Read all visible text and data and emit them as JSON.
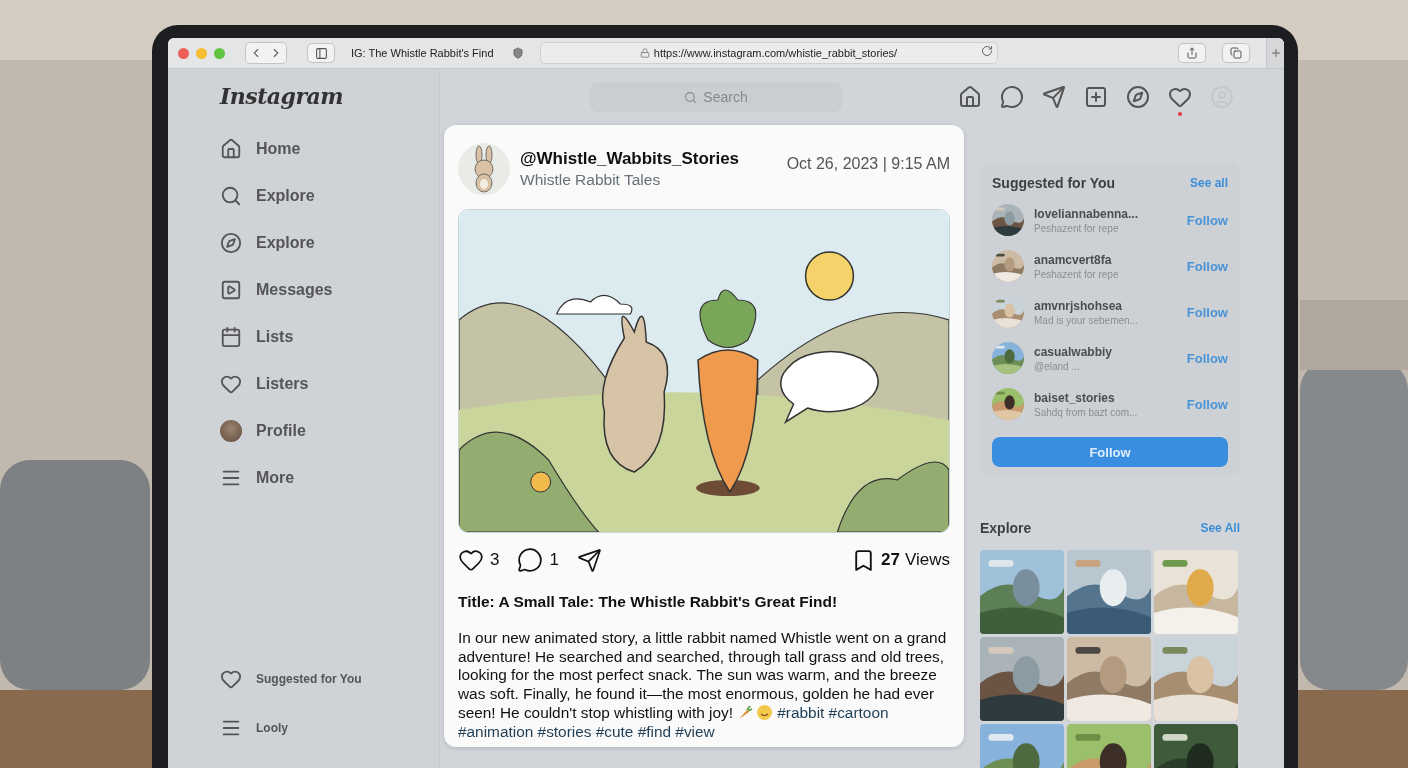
{
  "browser": {
    "tab_title": "IG: The Whistle Rabbit's Find",
    "url": "https://www.instagram.com/whistie_rabbit_stories/"
  },
  "sidebar": {
    "logo": "Instagram",
    "items": [
      {
        "kind": "home",
        "label": "Home"
      },
      {
        "kind": "search",
        "label": "Explore"
      },
      {
        "kind": "compass",
        "label": "Explore"
      },
      {
        "kind": "reels",
        "label": "Messages"
      },
      {
        "kind": "calendar",
        "label": "Lists"
      },
      {
        "kind": "heart",
        "label": "Listers"
      },
      {
        "kind": "avatar",
        "label": "Profile"
      },
      {
        "kind": "menu",
        "label": "More"
      }
    ],
    "bottom_items": [
      {
        "kind": "heart",
        "label": "Suggested for You"
      },
      {
        "kind": "menu",
        "label": "Looly"
      }
    ]
  },
  "top_nav": {
    "search_placeholder": "Search",
    "icons": [
      {
        "kind": "home",
        "notification": false
      },
      {
        "kind": "messenger",
        "notification": false
      },
      {
        "kind": "send",
        "notification": false
      },
      {
        "kind": "create",
        "notification": false
      },
      {
        "kind": "compass",
        "notification": false
      },
      {
        "kind": "heart",
        "notification": true
      },
      {
        "kind": "avatar",
        "notification": false
      }
    ]
  },
  "post": {
    "username": "@Whistle_Wabbits_Stories",
    "account_name": "Whistle Rabbit Tales",
    "timestamp": "Oct 26, 2023 | 9:15 AM",
    "likes": "3",
    "comments": "1",
    "views_count": "27",
    "views_label": "Views",
    "title": "Title: A Small Tale: The Whistle Rabbit's Great Find!",
    "body": "In our new animated story, a little rabbit named Whistle went on a grand adventure! He searched and searched, through tall grass and old trees, looking for the most perfect snack. The sun was warm, and the breeze was soft. Finally, he found it—the most enormous, golden he had ever seen! He couldn't stop whistling with joy!",
    "hashtags": [
      "#rabbit",
      "#cartoon",
      "#animation",
      "#stories",
      "#cute",
      "#find",
      "#view"
    ]
  },
  "suggestions": {
    "title": "Suggested for You",
    "see_all": "See all",
    "users": [
      {
        "name": "loveliannabenna...",
        "subtitle": "Peshazent for repe",
        "action": "Follow"
      },
      {
        "name": "anamcvert8fa",
        "subtitle": "Peshazent for repe",
        "action": "Follow"
      },
      {
        "name": "amvnrjshohsea",
        "subtitle": "Mad is your sebemen...",
        "action": "Follow"
      },
      {
        "name": "casualwabbiy",
        "subtitle": "@eland ...",
        "action": "Follow"
      },
      {
        "name": "baiset_stories",
        "subtitle": "Sahdq from bazt com...",
        "action": "Follow"
      }
    ],
    "button": "Follow"
  },
  "explore": {
    "title": "Explore",
    "see_all": "See All"
  }
}
